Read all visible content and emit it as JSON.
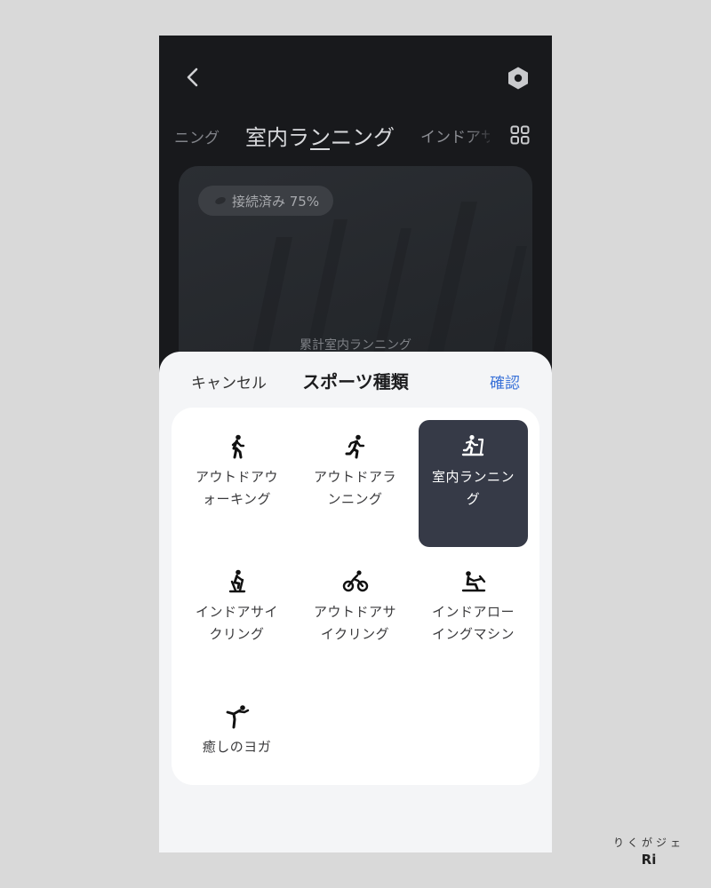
{
  "header": {
    "back_icon": "chevron-left-icon",
    "settings_icon": "hexagon-settings-icon"
  },
  "tabs": {
    "left_partial": "ニング",
    "active": "室内ランニング",
    "right_partial": "インドアサ",
    "grid_icon": "grid-icon"
  },
  "card": {
    "connection_status": "接続済み 75%",
    "caption": "累計室内ランニング"
  },
  "sheet": {
    "cancel_label": "キャンセル",
    "title": "スポーツ種類",
    "confirm_label": "確認"
  },
  "sports": [
    {
      "label": "アウトドアウォーキング",
      "icon": "walking-icon",
      "selected": false
    },
    {
      "label": "アウトドアランニング",
      "icon": "running-icon",
      "selected": false
    },
    {
      "label": "室内ランニング",
      "icon": "treadmill-icon",
      "selected": true
    },
    {
      "label": "インドアサイクリング",
      "icon": "indoor-bike-icon",
      "selected": false
    },
    {
      "label": "アウトドアサイクリング",
      "icon": "cycling-icon",
      "selected": false
    },
    {
      "label": "インドアローイングマシン",
      "icon": "rowing-icon",
      "selected": false
    },
    {
      "label": "癒しのヨガ",
      "icon": "yoga-icon",
      "selected": false
    }
  ],
  "colors": {
    "accent": "#3a72d8",
    "selected_tile": "#363a47",
    "background_dark": "#18191c"
  },
  "watermark": {
    "kana": "りくがジェ",
    "text": "Ri"
  }
}
